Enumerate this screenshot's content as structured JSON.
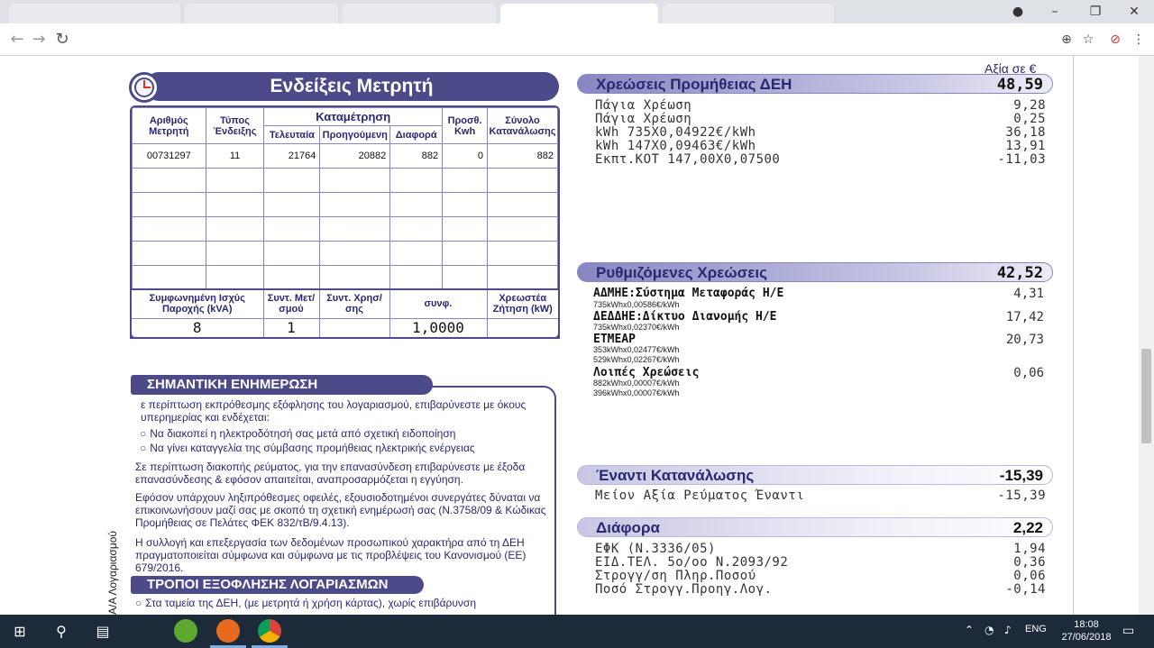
{
  "meter": {
    "title": "Ενδείξεις Μετρητή",
    "headers": {
      "meter_no": "Αριθμός Μετρητή",
      "reading_type": "Τύπος Ένδειξης",
      "measurement": "Καταμέτρηση",
      "last": "Τελευταία",
      "previous": "Προηγούμενη",
      "difference": "Διαφορά",
      "added_kwh": "Προσθ. Kwh",
      "total": "Σύνολο Κατανάλωσης"
    },
    "row": {
      "meter_no": "00731297",
      "reading_type": "11",
      "last": "21764",
      "previous": "20882",
      "difference": "882",
      "added_kwh": "0",
      "total": "882"
    },
    "cap_headers": {
      "agreed_power": "Συμφωνημένη Ισχύς Παροχής (kVA)",
      "coef_transformer": "Συντ. Μετ/σμού",
      "coef_usage": "Συντ. Χρησ/σης",
      "power_factor": "συνφ.",
      "billed_demand": "Χρεωστέα Ζήτηση (kW)"
    },
    "cap_values": {
      "agreed_power": "8",
      "coef_transformer": "1",
      "coef_usage": "",
      "power_factor": "1,0000",
      "billed_demand": ""
    }
  },
  "info": {
    "title": "ΣΗΜΑΝΤΙΚΗ ΕΝΗΜΕΡΩΣΗ",
    "p1": "ε περίπτωση εκπρόθεσμης εξόφλησης του λογαριασμού, επιβαρύνεστε με όκους υπερημερίας και ενδέχεται:",
    "b1": "Να διακοπεί η ηλεκτροδότησή σας μετά από σχετική ειδοποίηση",
    "b2": "Να γίνει καταγγελία της σύμβασης προμήθειας ηλεκτρικής ενέργειας",
    "p2": "Σε περίπτωση διακοπής ρεύματος, για την επανασύνδεση επιβαρύνεστε με έξοδα επανασύνδεσης & εφόσον απαιτείται, αναπροσαρμόζεται η εγγύηση.",
    "p3": "Εφόσον υπάρχουν ληξιπρόθεσμες οφειλές, εξουσιοδοτημένοι συνεργάτες δύναται να επικοινωνήσουν μαζί σας με σκοπό τη σχετική ενημέρωσή σας (Ν.3758/09 & Κώδικας Προμήθειας σε Πελάτες ΦΕΚ 832/τΒ/9.4.13).",
    "p4": "Η συλλογή και επεξεργασία των δεδομένων προσωπικού χαρακτήρα από τη ΔΕΗ πραγματοποιείται σύμφωνα και σύμφωνα με τις προβλέψεις του Κανονισμού (ΕΕ) 679/2016.",
    "pay_title": "ΤΡΟΠΟΙ ΕΞΟΦΛΗΣΗΣ ΛΟΓΑΡΙΑΣΜΩΝ",
    "pay_b1": "Στα ταμεία της ΔΕΗ, (με μετρητά ή χρήση κάρτας), χωρίς επιβάρυνση"
  },
  "side_text": "Α/Α Λογαριασμού",
  "charges": {
    "value_label": "Αξία σε €",
    "supply": {
      "title": "Χρεώσεις Προμήθειας ΔΕΗ",
      "amount": "48,59",
      "rows": [
        {
          "label": "Πάγια Χρέωση",
          "value": "9,28"
        },
        {
          "label": "Πάγια Χρέωση",
          "value": "0,25"
        },
        {
          "label": "kWh 735X0,04922€/kWh",
          "value": "36,18"
        },
        {
          "label": "kWh 147X0,09463€/kWh",
          "value": "13,91"
        },
        {
          "label": "Εκπτ.ΚΟΤ 147,00X0,07500",
          "value": "-11,03"
        }
      ]
    },
    "regulated": {
      "title": "Ρυθμιζόμενες Χρεώσεις",
      "amount": "42,52",
      "admie": {
        "label": "ΑΔΜΗΕ:Σύστημα Μεταφοράς Η/Ε",
        "value": "4,31",
        "sub1": "735kWhx0,00586€/kWh"
      },
      "deddie": {
        "label": "ΔΕΔΔΗΕ:Δίκτυο Διανομής Η/Ε",
        "value": "17,42",
        "sub1": "735kWhx0,02370€/kWh"
      },
      "etmear": {
        "label": "ΕΤΜΕΑΡ",
        "value": "20,73",
        "sub1": "353kWhx0,02477€/kWh",
        "sub2": "529kWhx0,02267€/kWh"
      },
      "other": {
        "label": "Λοιπές Χρεώσεις",
        "value": "0,06",
        "sub1": "882kWhx0,00007€/kWh",
        "sub2": "396kWhx0,00007€/kWh"
      }
    },
    "against": {
      "title": "Έναντι Κατανάλωσης",
      "amount": "-15,39",
      "rows": [
        {
          "label": "Μείον Αξία Ρεύματος Έναντι",
          "value": "-15,39"
        }
      ]
    },
    "diff": {
      "title": "Διάφορα",
      "amount": "2,22",
      "rows": [
        {
          "label": "ΕΦΚ (Ν.3336/05)",
          "value": "1,94"
        },
        {
          "label": "ΕΙΔ.ΤΕΛ. 5ο/οο Ν.2093/92",
          "value": "0,36"
        },
        {
          "label": "Στρογγ/ση Πληρ.Ποσού",
          "value": "0,06"
        },
        {
          "label": "Ποσό Στρογγ.Προηγ.Λογ.",
          "value": "-0,14"
        }
      ]
    }
  },
  "taskbar": {
    "lang": "ENG",
    "time": "18:08",
    "date": "27/06/2018"
  }
}
